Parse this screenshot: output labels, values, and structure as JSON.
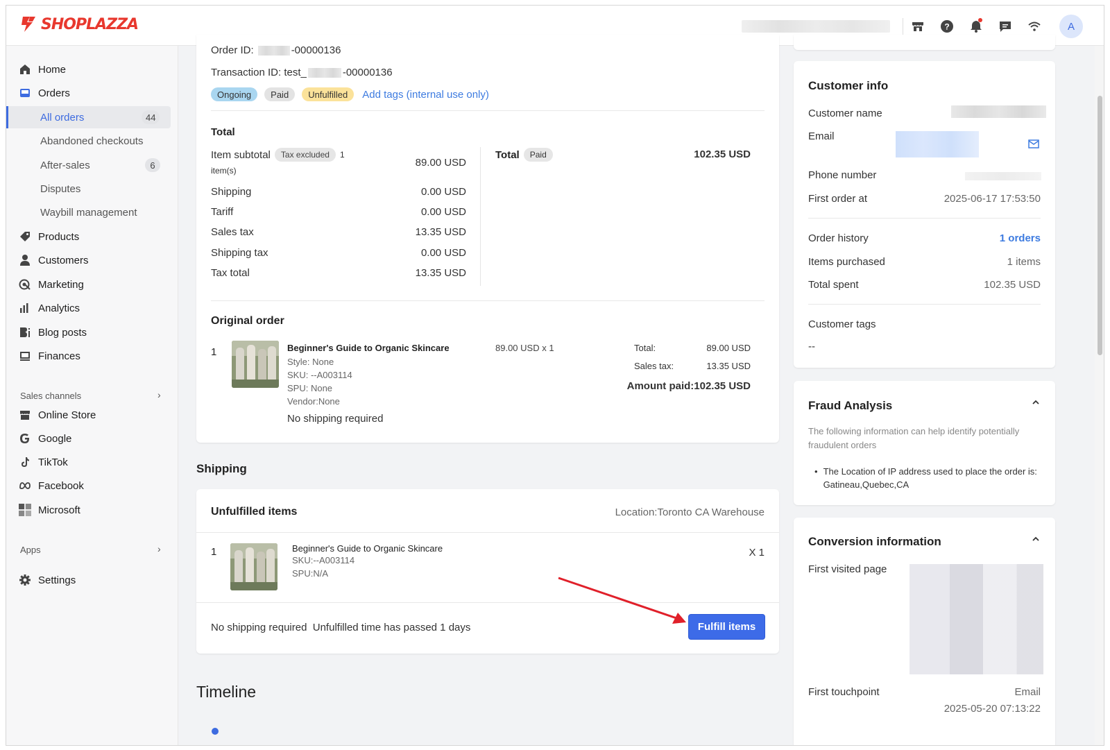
{
  "brand": {
    "name": "SHOPLAZZA",
    "accent": "#e8382e",
    "primary": "#3d6be8"
  },
  "topbar": {
    "avatar_letter": "A"
  },
  "sidebar": {
    "items": [
      {
        "label": "Home",
        "icon": "home-icon"
      },
      {
        "label": "Orders",
        "icon": "orders-icon"
      },
      {
        "label": "Products",
        "icon": "tag-icon"
      },
      {
        "label": "Customers",
        "icon": "person-icon"
      },
      {
        "label": "Marketing",
        "icon": "marketing-icon"
      },
      {
        "label": "Analytics",
        "icon": "bar-chart-icon"
      },
      {
        "label": "Blog posts",
        "icon": "blog-icon"
      },
      {
        "label": "Finances",
        "icon": "finance-icon"
      }
    ],
    "orders_sub": [
      {
        "label": "All orders",
        "count": "44"
      },
      {
        "label": "Abandoned checkouts"
      },
      {
        "label": "After-sales",
        "count": "6"
      },
      {
        "label": "Disputes"
      },
      {
        "label": "Waybill management"
      }
    ],
    "sales_channels_label": "Sales channels",
    "channels": [
      {
        "label": "Online Store"
      },
      {
        "label": "Google"
      },
      {
        "label": "TikTok"
      },
      {
        "label": "Facebook"
      },
      {
        "label": "Microsoft"
      }
    ],
    "apps_label": "Apps",
    "settings_label": "Settings"
  },
  "order": {
    "order_id_label": "Order ID:",
    "order_id_suffix": "-00000136",
    "transaction_label": "Transaction ID: test_",
    "transaction_suffix": "-00000136",
    "tags": [
      "Ongoing",
      "Paid",
      "Unfulfilled"
    ],
    "add_tags": "Add tags (internal use only)",
    "total_heading": "Total",
    "item_subtotal_label": "Item subtotal",
    "tax_excluded": "Tax excluded",
    "item_count": "1",
    "items_unit": "item(s)",
    "item_subtotal": "89.00 USD",
    "rows": [
      {
        "label": "Shipping",
        "value": "0.00 USD"
      },
      {
        "label": "Tariff",
        "value": "0.00 USD"
      },
      {
        "label": "Sales tax",
        "value": "13.35 USD"
      },
      {
        "label": "Shipping tax",
        "value": "0.00 USD"
      },
      {
        "label": "Tax total",
        "value": "13.35 USD"
      }
    ],
    "total_label": "Total",
    "total_paid_tag": "Paid",
    "total_value": "102.35 USD",
    "original_order_heading": "Original order",
    "line_index": "1",
    "product_name": "Beginner's Guide to Organic Skincare",
    "style": "Style: None",
    "sku": "SKU: --A003114",
    "spu": "SPU: None",
    "vendor": "Vendor:None",
    "price_qty": "89.00 USD x 1",
    "line_total_label": "Total:",
    "line_total_value": "89.00 USD",
    "line_tax_label": "Sales tax:",
    "line_tax_value": "13.35 USD",
    "amount_paid": "Amount paid:102.35 USD",
    "no_shipping": "No shipping required"
  },
  "shipping": {
    "heading": "Shipping",
    "unfulfilled_heading": "Unfulfilled items",
    "location": "Location:Toronto CA Warehouse",
    "line_index": "1",
    "product_name": "Beginner's Guide to Organic Skincare",
    "sku": "SKU:--A003114",
    "spu": "SPU:N/A",
    "qty": "X 1",
    "footer_text": "No shipping required  Unfulfilled time has passed 1 days",
    "fulfill_button": "Fulfill items"
  },
  "timeline": {
    "heading": "Timeline"
  },
  "customer": {
    "heading": "Customer info",
    "name_label": "Customer name",
    "email_label": "Email",
    "phone_label": "Phone number",
    "first_order_label": "First order at",
    "first_order_value": "2025-06-17 17:53:50",
    "order_history_label": "Order history",
    "order_history_value": "1 orders",
    "items_purchased_label": "Items purchased",
    "items_purchased_value": "1 items",
    "total_spent_label": "Total spent",
    "total_spent_value": "102.35 USD",
    "tags_label": "Customer tags",
    "tags_value": "--"
  },
  "fraud": {
    "heading": "Fraud Analysis",
    "description": "The following information can help identify potentially fraudulent orders",
    "bullet": "The Location of IP address used to place the order is: Gatineau,Quebec,CA"
  },
  "conversion": {
    "heading": "Conversion information",
    "first_visited_label": "First visited page",
    "first_touchpoint_label": "First touchpoint",
    "first_touchpoint_value": "Email",
    "first_touchpoint_time": "2025-05-20 07:13:22"
  }
}
